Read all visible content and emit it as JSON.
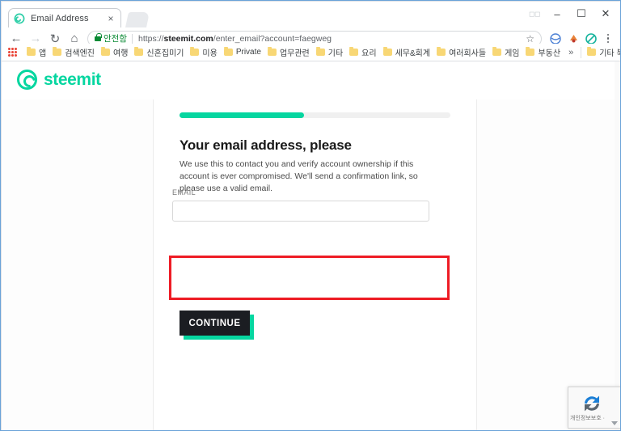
{
  "browser": {
    "tab": {
      "title": "Email Address",
      "favicon": "steemit-favicon",
      "close_label": "×"
    },
    "window_controls": {
      "cast": "cast-icon",
      "minimize": "–",
      "maximize": "☐",
      "close": "✕"
    },
    "toolbar": {
      "back": "←",
      "forward": "→",
      "reload": "↻",
      "home": "⌂",
      "secure_text": "안전함",
      "url_prefix": "https://",
      "url_domain": "steemit.com",
      "url_path": "/enter_email?account=faegweg",
      "star": "☆",
      "menu": "kebab-menu"
    },
    "bookmarks": {
      "apps_label": "apps-grid-icon",
      "items": [
        {
          "label": "앱"
        },
        {
          "label": "검색엔진"
        },
        {
          "label": "여행"
        },
        {
          "label": "신혼집꫾미기"
        },
        {
          "label": "미용"
        },
        {
          "label": "Private"
        },
        {
          "label": "업무관련"
        },
        {
          "label": "기타"
        },
        {
          "label": "요리"
        },
        {
          "label": "세무&회계"
        },
        {
          "label": "여러회사들"
        },
        {
          "label": "게임"
        },
        {
          "label": "부동산"
        }
      ],
      "overflow": "»",
      "other_bookmarks": "기타 북마크"
    }
  },
  "page": {
    "site_name": "steemit",
    "progress": {
      "percent": 46,
      "fill_color": "#06d6a0",
      "track_color": "#f0f0f0"
    },
    "headline": "Your email address, please",
    "blurb": "We use this to contact you and verify account ownership if this account is ever compromised. We'll send a confirmation link, so please use a valid email.",
    "form": {
      "email_label": "EMAIL",
      "email_value": "",
      "email_placeholder": "",
      "continue_label": "CONTINUE"
    },
    "recaptcha": {
      "text": "개인정보보호 ·"
    },
    "annotation": {
      "type": "red-rectangle",
      "color": "#ee1c25",
      "targets": "email-field-group"
    },
    "colors": {
      "accent": "#06d6a0",
      "button_bg": "#1b1d22",
      "annotation": "#ee1c25"
    }
  }
}
